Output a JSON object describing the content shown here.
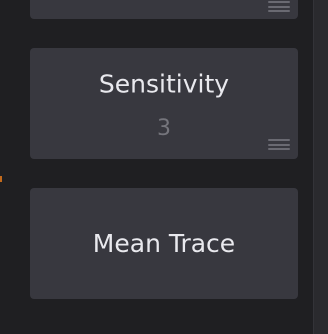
{
  "tiles": {
    "top": {
      "label": ""
    },
    "sensitivity": {
      "label": "Sensitivity",
      "value": "3"
    },
    "mean_trace": {
      "label": "Mean Trace"
    }
  },
  "icons": {
    "grip": "drag-handle-icon"
  },
  "colors": {
    "background": "#1f1f22",
    "tile": "#38383f",
    "text": "#e9e9ee",
    "value_text": "#75757c",
    "accent": "#c26a1c"
  }
}
